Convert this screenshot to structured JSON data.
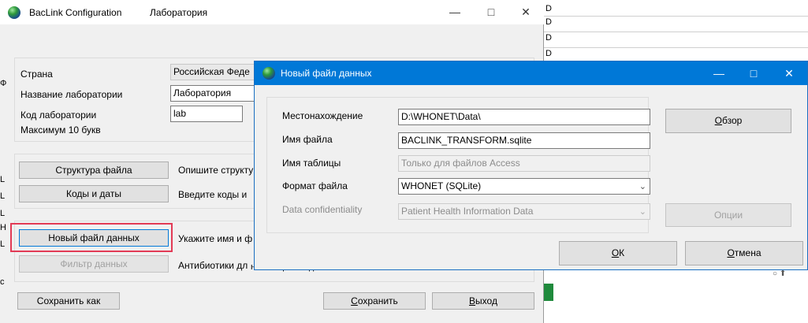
{
  "main_window": {
    "app_title": "BacLink Configuration",
    "sub_title": "Лаборатория",
    "fields": {
      "country_label": "Страна",
      "country_value": "Российская Феде",
      "lab_name_label": "Название лаборатории",
      "lab_name_value": "Лаборатория",
      "lab_code_label": "Код лаборатории",
      "lab_code_value": "lab",
      "max_hint": "Максимум 10 букв"
    },
    "actions": {
      "file_structure_btn": "Структура файла",
      "file_structure_desc": "Опишите структу",
      "codes_dates_btn": "Коды и даты",
      "codes_dates_desc": "Введите коды и",
      "new_data_file_btn": "Новый файл данных",
      "new_data_file_desc": "Укажите имя и ф",
      "data_filter_btn": "Фильтр данных",
      "data_filter_desc": "Антибиотики дл"
    },
    "footer": {
      "save_as": "Сохранить как",
      "save_underlined": "С",
      "save_rest": "охранить",
      "exit_underlined": "В",
      "exit_rest": "ыход"
    }
  },
  "dialog": {
    "title": "Новый файл данных",
    "location_label": "Местонахождение",
    "location_value": "D:\\WHONET\\Data\\",
    "filename_label": "Имя файла",
    "filename_value": "BACLINK_TRANSFORM.sqlite",
    "table_label": "Имя таблицы",
    "table_placeholder": "Только для файлов Access",
    "format_label": "Формат файла",
    "format_value": "WHONET (SQLite)",
    "confidentiality_label": "Data confidentiality",
    "confidentiality_value": "Patient Health Information Data",
    "browse_underlined": "О",
    "browse_rest": "бзор",
    "options_btn": "Опции",
    "ok_underlined": "О",
    "ok_rest": "К",
    "cancel_underlined": "О",
    "cancel_rest": "тмена"
  },
  "background": {
    "right_chars": [
      "D",
      "D",
      "D",
      "D"
    ],
    "left_chars": [
      "Ф",
      "L",
      "L",
      "L",
      "Н",
      "L",
      "с"
    ],
    "partial_text": "нового файла данных",
    "search_glyph": "○ ⬆"
  }
}
